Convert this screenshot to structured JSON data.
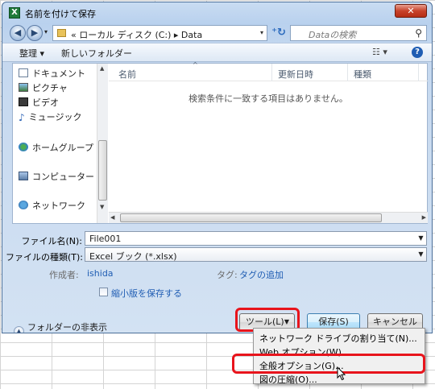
{
  "window": {
    "title": "名前を付けて保存",
    "app_icon": "X",
    "close_label": "✕"
  },
  "address_bar": {
    "path": "« ローカル ディスク (C:) ▸ Data",
    "search_placeholder": "Dataの検索"
  },
  "toolbar": {
    "organize_label": "整理 ▾",
    "new_folder_label": "新しいフォルダー",
    "views_label": "☷ ▾",
    "help_label": "?"
  },
  "nav_pane": {
    "items": [
      {
        "label": "ドキュメント",
        "icon": "document-icon"
      },
      {
        "label": "ピクチャ",
        "icon": "pictures-icon"
      },
      {
        "label": "ビデオ",
        "icon": "video-icon"
      },
      {
        "label": "ミュージック",
        "icon": "music-icon"
      },
      {
        "label": "ホームグループ",
        "icon": "homegroup-icon"
      },
      {
        "label": "コンピューター",
        "icon": "computer-icon"
      },
      {
        "label": "ネットワーク",
        "icon": "network-icon"
      }
    ]
  },
  "file_list": {
    "columns": [
      "名前",
      "更新日時",
      "種類"
    ],
    "empty_message": "検索条件に一致する項目はありません。"
  },
  "form": {
    "filename_label": "ファイル名(N):",
    "filename_value": "File001",
    "filetype_label": "ファイルの種類(T):",
    "filetype_value": "Excel ブック (*.xlsx)",
    "author_label": "作成者:",
    "author_value": "ishida",
    "tags_label": "タグ:",
    "tags_value": "タグの追加",
    "thumbnail_label": "縮小版を保存する",
    "thumbnail_checked": false
  },
  "footer": {
    "hide_folders_label": "フォルダーの非表示",
    "tools_label": "ツール(L)",
    "save_label": "保存(S)",
    "cancel_label": "キャンセル"
  },
  "tools_menu": {
    "items": [
      "ネットワーク ドライブの割り当て(N)...",
      "Web オプション(W)...",
      "全般オプション(G)...",
      "図の圧縮(O)..."
    ],
    "highlighted_item": "全般オプション(G)..."
  },
  "colors": {
    "highlight_box": "#e8141c",
    "link": "#1f5db3"
  }
}
